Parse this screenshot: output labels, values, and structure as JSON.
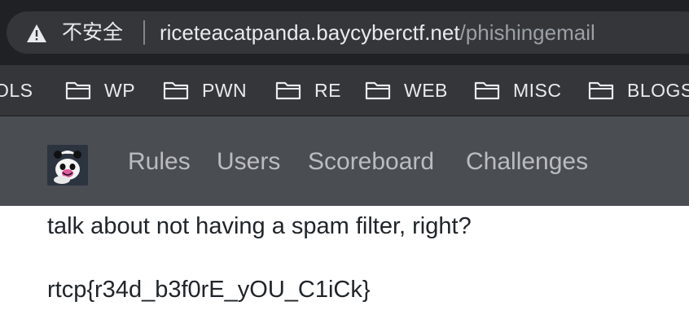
{
  "browser": {
    "security_label": "不安全",
    "url_host": "riceteacatpanda.baycyberctf.net",
    "url_path": "/phishingemail"
  },
  "bookmarks": [
    {
      "label": "OLS",
      "folder": false
    },
    {
      "label": "WP",
      "folder": true
    },
    {
      "label": "PWN",
      "folder": true
    },
    {
      "label": "RE",
      "folder": true
    },
    {
      "label": "WEB",
      "folder": true
    },
    {
      "label": "MISC",
      "folder": true
    },
    {
      "label": "BLOGS",
      "folder": true
    }
  ],
  "site_nav": {
    "links": [
      "Rules",
      "Users",
      "Scoreboard",
      "Challenges"
    ]
  },
  "content": {
    "line1": "talk about not having a spam filter, right?",
    "flag": "rtcp{r34d_b3f0rE_yOU_C1iCk}"
  },
  "colors": {
    "browser_dark": "#202124",
    "omnibox": "#35363a",
    "navbar": "#4a4d52",
    "nav_link": "#b9bcc1",
    "text": "#212529"
  }
}
